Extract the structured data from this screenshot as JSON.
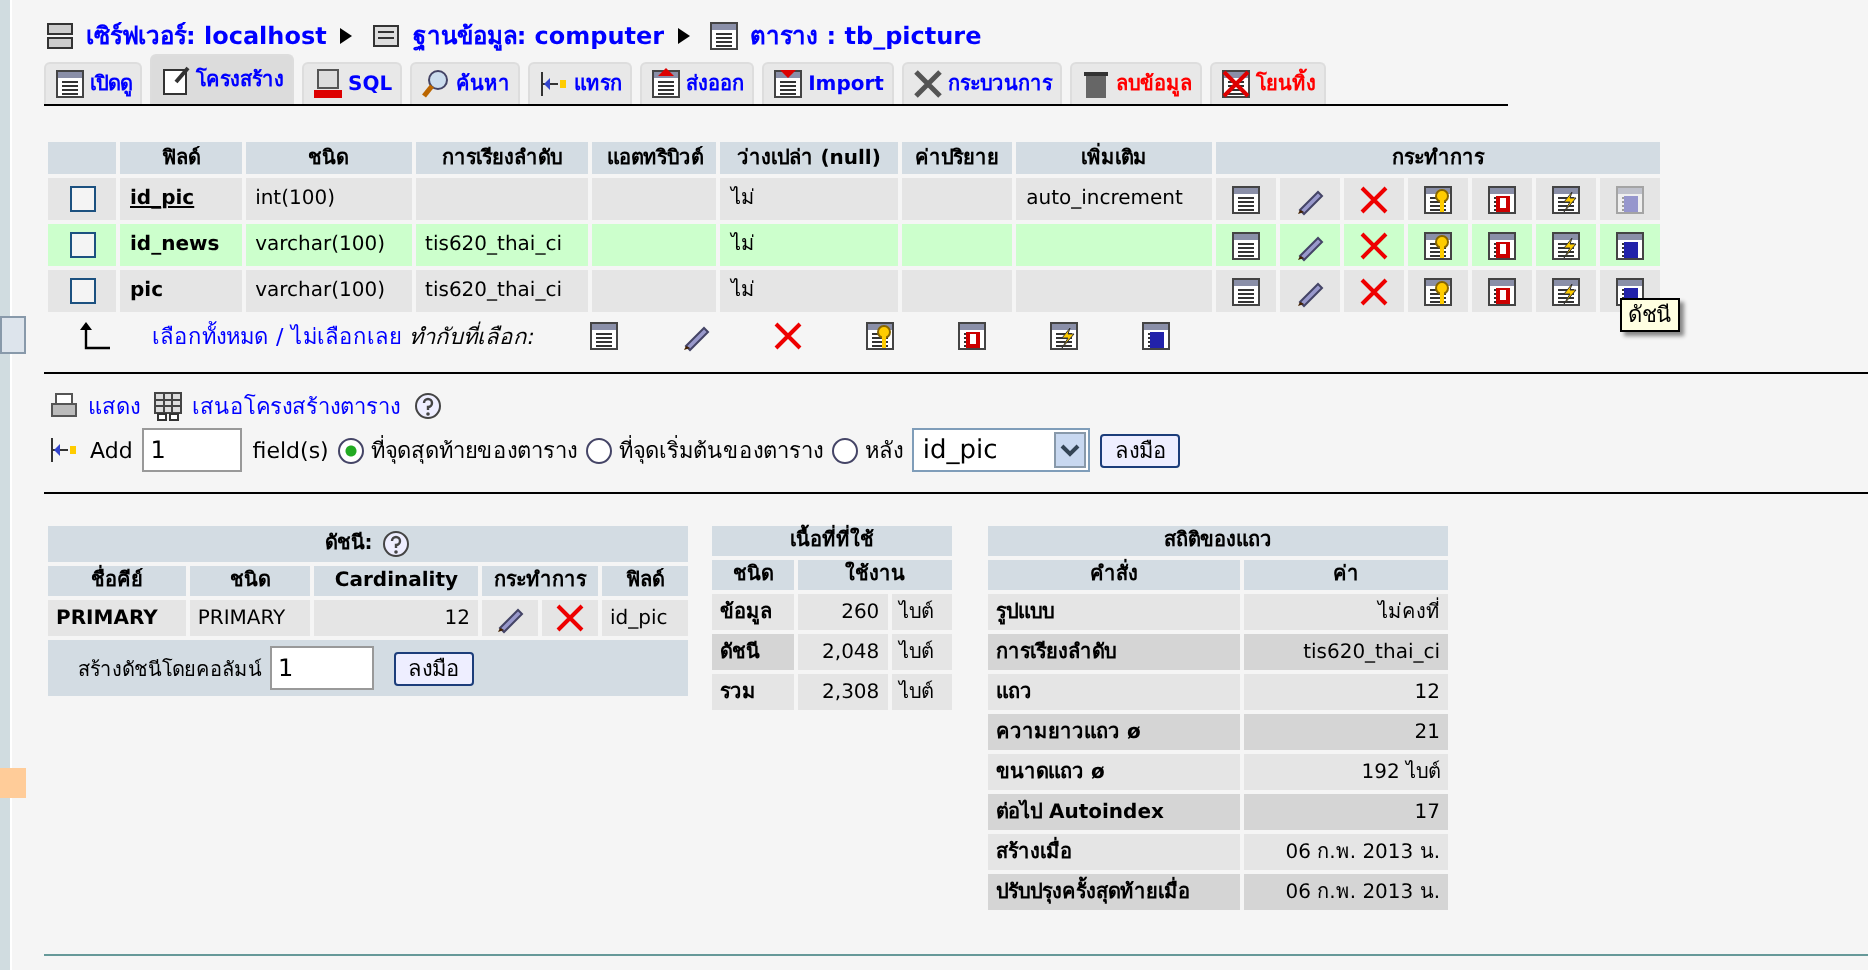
{
  "breadcrumb": [
    {
      "kind": "server",
      "label": "เซิร์ฟเวอร์: localhost"
    },
    {
      "kind": "database",
      "label": "ฐานข้อมูล: computer"
    },
    {
      "kind": "table",
      "label": "ตาราง : tb_picture"
    }
  ],
  "tabs": [
    {
      "kind": "browse",
      "label": "เปิดดู",
      "selected": false,
      "danger": false
    },
    {
      "kind": "structure",
      "label": "โครงสร้าง",
      "selected": true,
      "danger": false
    },
    {
      "kind": "sql",
      "label": "SQL",
      "selected": false,
      "danger": false
    },
    {
      "kind": "search",
      "label": "ค้นหา",
      "selected": false,
      "danger": false
    },
    {
      "kind": "insert",
      "label": "แทรก",
      "selected": false,
      "danger": false
    },
    {
      "kind": "export",
      "label": "ส่งออก",
      "selected": false,
      "danger": false
    },
    {
      "kind": "import",
      "label": "Import",
      "selected": false,
      "danger": false
    },
    {
      "kind": "operations",
      "label": "กระบวนการ",
      "selected": false,
      "danger": false
    },
    {
      "kind": "empty",
      "label": "ลบข้อมูล",
      "selected": false,
      "danger": true
    },
    {
      "kind": "drop",
      "label": "โยนทิ้ง",
      "selected": false,
      "danger": true
    }
  ],
  "structure": {
    "columns": [
      "ฟิลด์",
      "ชนิด",
      "การเรียงลำดับ",
      "แอตทริบิวต์",
      "ว่างเปล่า (null)",
      "ค่าปริยาย",
      "เพิ่มเติม",
      "กระทำการ"
    ],
    "rows": [
      {
        "field": "id_pic",
        "type": "int(100)",
        "collation": "",
        "null": "ไม่",
        "extra": "auto_increment",
        "primary": true,
        "highlighted": false,
        "checked": false,
        "actions": [
          {
            "kind": "browse",
            "disabled": false
          },
          {
            "kind": "edit",
            "disabled": false
          },
          {
            "kind": "drop",
            "disabled": false
          },
          {
            "kind": "primary",
            "disabled": false
          },
          {
            "kind": "unique",
            "disabled": false
          },
          {
            "kind": "index",
            "disabled": false
          },
          {
            "kind": "fulltext",
            "disabled": true
          }
        ]
      },
      {
        "field": "id_news",
        "type": "varchar(100)",
        "collation": "tis620_thai_ci",
        "null": "ไม่",
        "extra": "",
        "primary": false,
        "highlighted": true,
        "checked": false,
        "actions": [
          {
            "kind": "browse",
            "disabled": false
          },
          {
            "kind": "edit",
            "disabled": false
          },
          {
            "kind": "drop",
            "disabled": false
          },
          {
            "kind": "primary",
            "disabled": false
          },
          {
            "kind": "unique",
            "disabled": false
          },
          {
            "kind": "index",
            "disabled": false
          },
          {
            "kind": "fulltext",
            "disabled": false
          }
        ]
      },
      {
        "field": "pic",
        "type": "varchar(100)",
        "collation": "tis620_thai_ci",
        "null": "ไม่",
        "extra": "",
        "primary": false,
        "highlighted": false,
        "checked": false,
        "actions": [
          {
            "kind": "browse",
            "disabled": false
          },
          {
            "kind": "edit",
            "disabled": false
          },
          {
            "kind": "drop",
            "disabled": false
          },
          {
            "kind": "primary",
            "disabled": false
          },
          {
            "kind": "unique",
            "disabled": false
          },
          {
            "kind": "index",
            "disabled": false
          },
          {
            "kind": "fulltext",
            "disabled": false,
            "tooltip": "ดัชนี"
          }
        ]
      }
    ]
  },
  "with_selected": {
    "check_all": "เลือกทั้งหมด",
    "separator": "/",
    "uncheck_all": "ไม่เลือกเลย",
    "label": "ทำกับที่เลือก:",
    "actions": [
      {
        "kind": "browse"
      },
      {
        "kind": "edit"
      },
      {
        "kind": "drop"
      },
      {
        "kind": "primary"
      },
      {
        "kind": "unique"
      },
      {
        "kind": "index"
      },
      {
        "kind": "fulltext"
      }
    ]
  },
  "links": [
    {
      "kind": "print",
      "label": "แสดง"
    },
    {
      "kind": "propose",
      "label": "เสนอโครงสร้างตาราง"
    },
    {
      "kind": "help"
    }
  ],
  "add_field": {
    "label": "Add",
    "value": "1",
    "unit": "field(s)",
    "positions": [
      {
        "label": "ที่จุดสุดท้ายของตาราง",
        "selected": true
      },
      {
        "label": "ที่จุดเริ่มต้นของตาราง",
        "selected": false
      },
      {
        "label": "หลัง",
        "selected": false
      }
    ],
    "after_field": "id_pic",
    "button": "ลงมือ"
  },
  "indexes": {
    "title": "ดัชนี:",
    "columns": [
      "ชื่อคีย์",
      "ชนิด",
      "Cardinality",
      "กระทำการ",
      "ฟิลด์"
    ],
    "rows": [
      {
        "keyname": "PRIMARY",
        "type": "PRIMARY",
        "cardinality": "12",
        "field": "id_pic"
      }
    ],
    "create_label": "สร้างดัชนีโดยคอลัมน์",
    "create_value": "1",
    "button": "ลงมือ"
  },
  "space_usage": {
    "title": "เนื้อที่ที่ใช้",
    "columns": [
      "ชนิด",
      "ใช้งาน"
    ],
    "rows": [
      {
        "type": "ข้อมูล",
        "value": "260",
        "unit": "ไบต์"
      },
      {
        "type": "ดัชนี",
        "value": "2,048",
        "unit": "ไบต์"
      },
      {
        "type": "รวม",
        "value": "2,308",
        "unit": "ไบต์"
      }
    ]
  },
  "row_stats": {
    "title": "สถิติของแถว",
    "columns": [
      "คำสั่ง",
      "ค่า"
    ],
    "rows": [
      {
        "label": "รูปแบบ",
        "value": "ไม่คงที่"
      },
      {
        "label": "การเรียงลำดับ",
        "value": "tis620_thai_ci"
      },
      {
        "label": "แถว",
        "value": "12"
      },
      {
        "label": "ความยาวแถว ø",
        "value": "21"
      },
      {
        "label": "ขนาดแถว ø",
        "value": "192 ไบต์"
      },
      {
        "label": "ต่อไป Autoindex",
        "value": "17"
      },
      {
        "label": "สร้างเมื่อ",
        "value": "06 ก.พ. 2013 น."
      },
      {
        "label": "ปรับปรุงครั้งสุดท้ายเมื่อ",
        "value": "06 ก.พ. 2013 น."
      }
    ]
  }
}
